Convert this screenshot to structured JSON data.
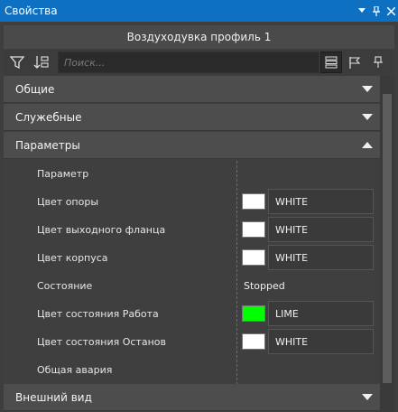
{
  "window": {
    "title": "Свойства",
    "menu_icon": "dropdown-arrow-icon",
    "pin_icon": "pin-icon",
    "close_icon": "close-icon"
  },
  "header": {
    "title": "Воздуходувка профиль 1"
  },
  "toolbar": {
    "filter_icon": "filter-icon",
    "sort_icon": "sort-icon",
    "search_placeholder": "Поиск...",
    "view_list_icon": "list-view-icon",
    "flag_icon": "flag-icon",
    "pin_icon": "pin-icon"
  },
  "sections": [
    {
      "label": "Общие",
      "expanded": false
    },
    {
      "label": "Служебные",
      "expanded": false
    },
    {
      "label": "Параметры",
      "expanded": true
    },
    {
      "label": "Внешний вид",
      "expanded": false
    }
  ],
  "properties": [
    {
      "label": "Параметр",
      "value": "",
      "type": "empty"
    },
    {
      "label": "Цвет опоры",
      "value": "WHITE",
      "swatch": "#ffffff",
      "type": "color"
    },
    {
      "label": "Цвет выходного фланца",
      "value": "WHITE",
      "swatch": "#ffffff",
      "type": "color"
    },
    {
      "label": "Цвет корпуса",
      "value": "WHITE",
      "swatch": "#ffffff",
      "type": "color"
    },
    {
      "label": "Состояние",
      "value": "Stopped",
      "type": "text"
    },
    {
      "label": "Цвет состояния Работа",
      "value": "LIME",
      "swatch": "#00ff00",
      "type": "color"
    },
    {
      "label": "Цвет состояния Останов",
      "value": "WHITE",
      "swatch": "#ffffff",
      "type": "color"
    },
    {
      "label": "Общая авария",
      "value": "",
      "type": "empty"
    }
  ],
  "colors": {
    "titlebar": "#0e70c0",
    "lime": "#00ff00",
    "white": "#ffffff"
  }
}
